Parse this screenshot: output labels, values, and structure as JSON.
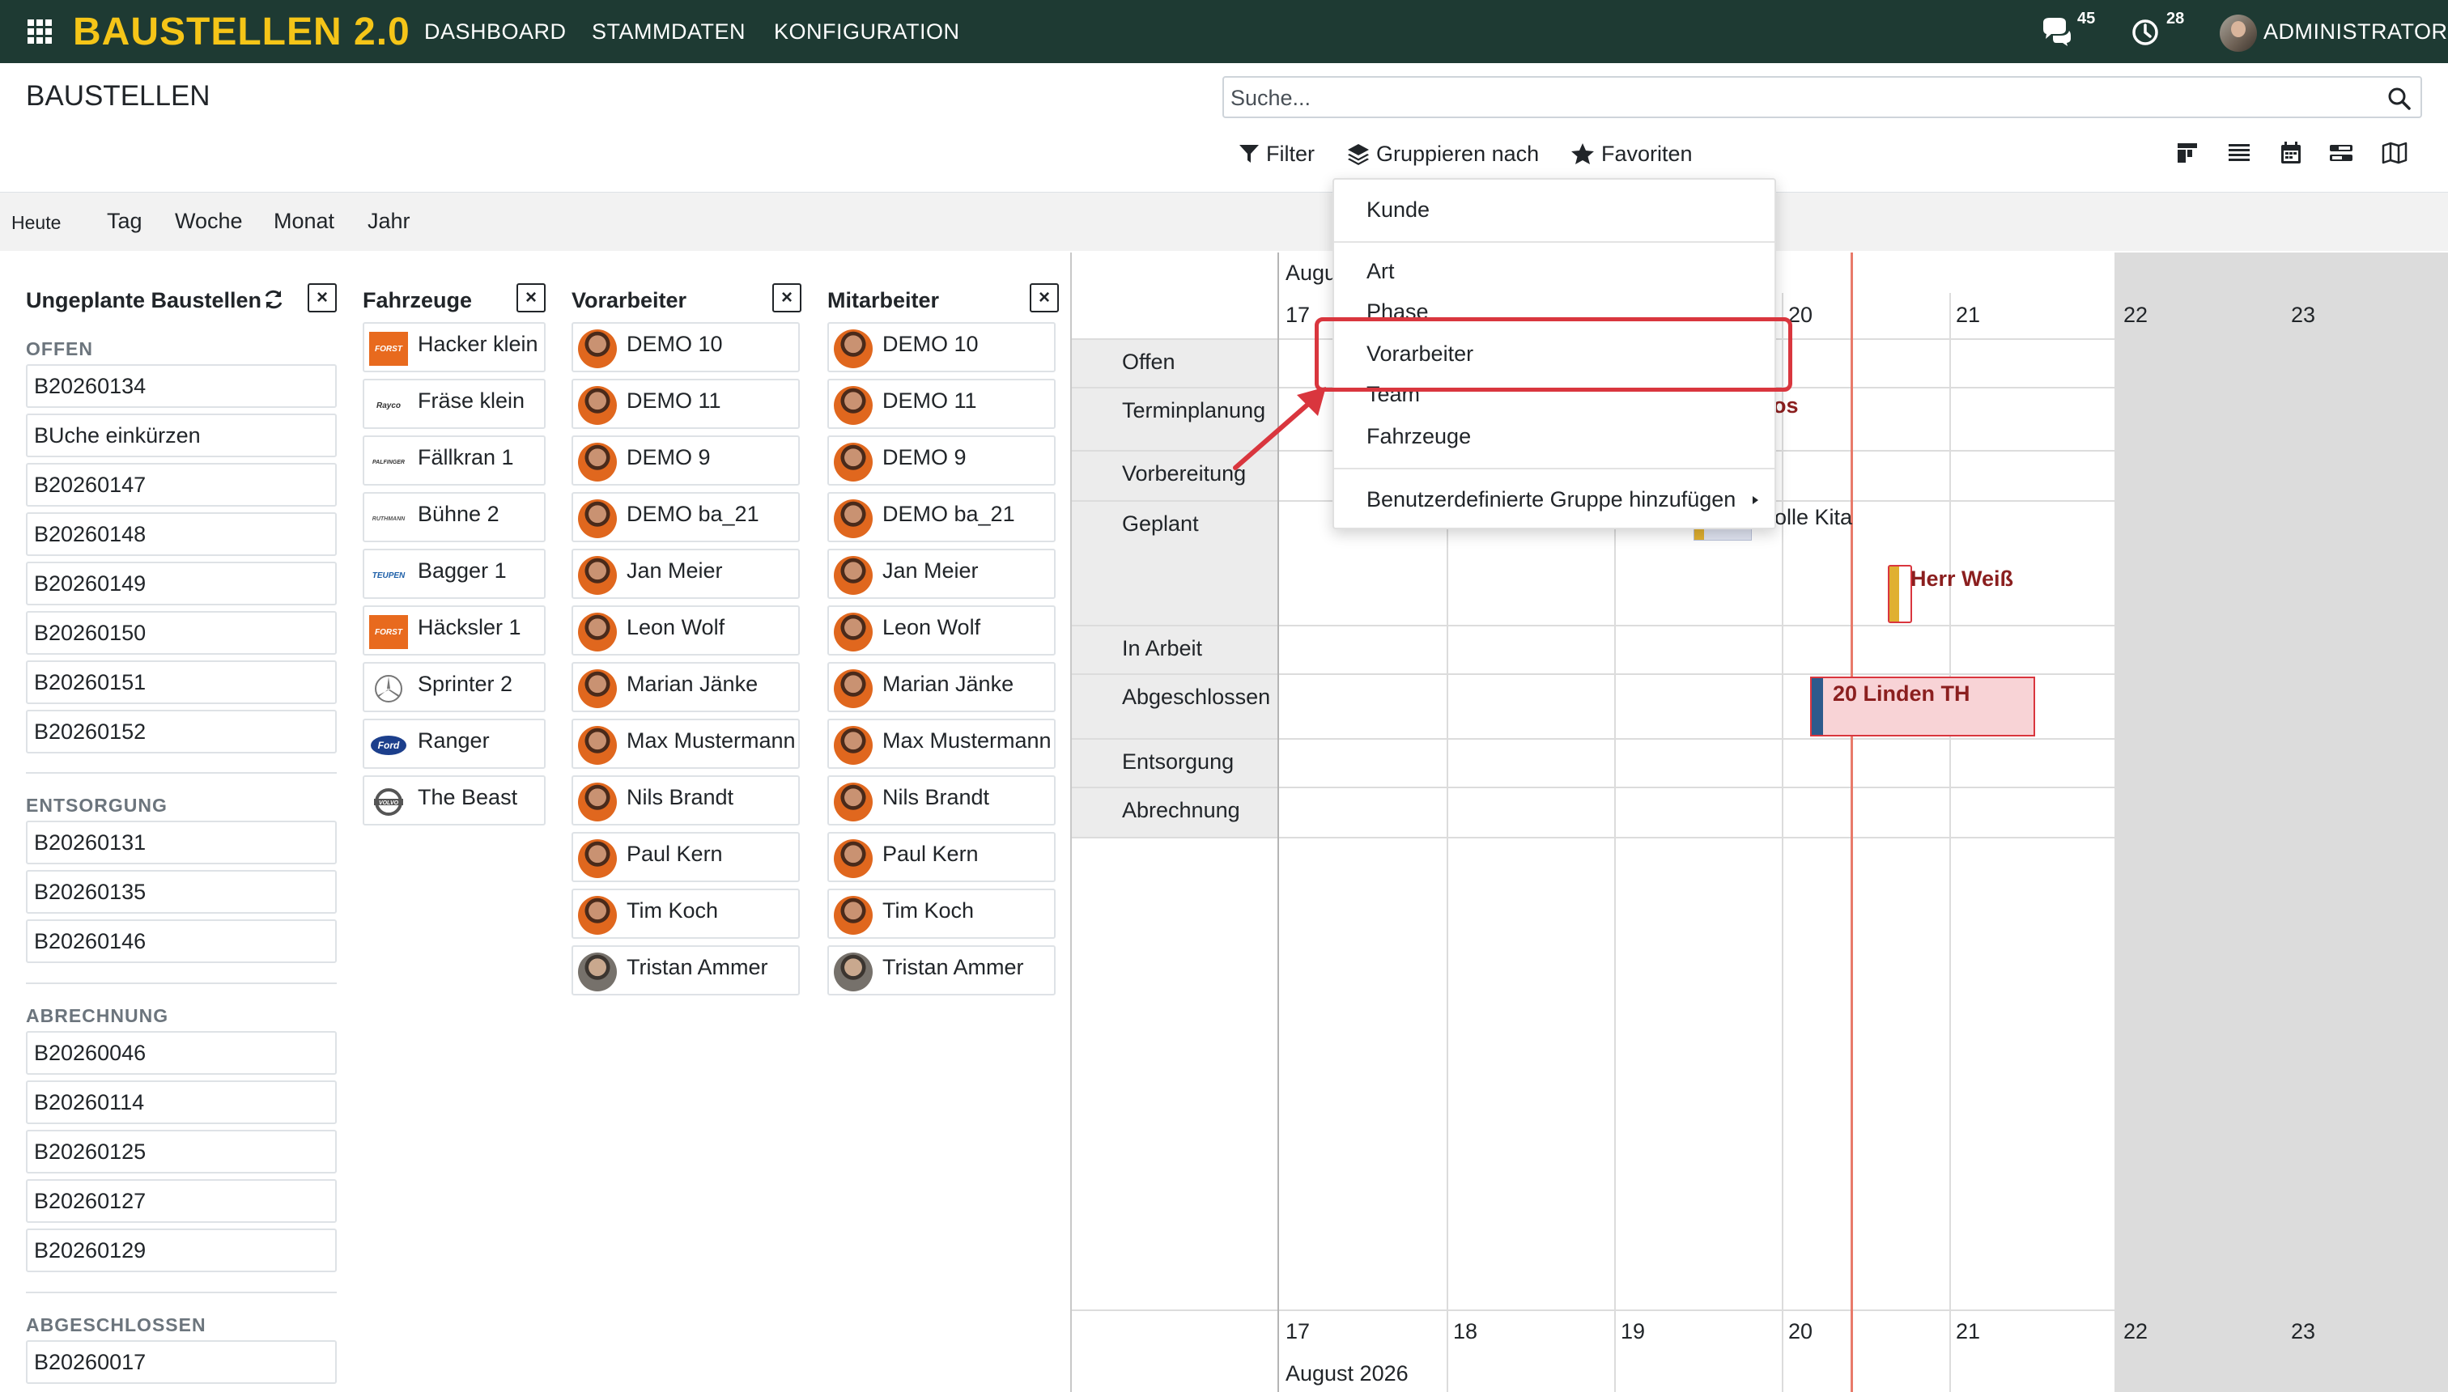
{
  "navbar": {
    "brand": "BAUSTELLEN 2.0",
    "links": [
      "DASHBOARD",
      "STAMMDATEN",
      "KONFIGURATION"
    ],
    "messages_count": "45",
    "activities_count": "28",
    "user": "ADMINISTRATOR",
    "icons": {
      "apps": "apps-grid-icon",
      "messages": "chat-icon",
      "activities": "clock-icon"
    }
  },
  "control_panel": {
    "title": "BAUSTELLEN",
    "search_placeholder": "Suche...",
    "filter_label": "Filter",
    "group_by_label": "Gruppieren nach",
    "favorites_label": "Favoriten",
    "views": [
      "kanban-icon",
      "list-icon",
      "calendar-icon",
      "timeline-icon",
      "map-icon"
    ]
  },
  "scale": {
    "today": "Heute",
    "day": "Tag",
    "week": "Woche",
    "month": "Monat",
    "year": "Jahr"
  },
  "unplanned": {
    "title": "Ungeplante Baustellen",
    "groups": [
      {
        "name": "OFFEN",
        "items": [
          "B20260134",
          "BUche einkürzen",
          "B20260147",
          "B20260148",
          "B20260149",
          "B20260150",
          "B20260151",
          "B20260152"
        ]
      },
      {
        "name": "ENTSORGUNG",
        "items": [
          "B20260131",
          "B20260135",
          "B20260146"
        ]
      },
      {
        "name": "ABRECHNUNG",
        "items": [
          "B20260046",
          "B20260114",
          "B20260125",
          "B20260127",
          "B20260129"
        ]
      },
      {
        "name": "ABGESCHLOSSEN",
        "items": [
          "B20260017"
        ]
      }
    ]
  },
  "vehicles": {
    "title": "Fahrzeuge",
    "items": [
      {
        "name": "Hacker klein",
        "logo": "FORST",
        "logo_color": "#e86a1e"
      },
      {
        "name": "Fräse klein",
        "logo": "Rayco",
        "logo_color": "#333333"
      },
      {
        "name": "Fällkran 1",
        "logo": "PALFINGER",
        "logo_color": "#333333"
      },
      {
        "name": "Bühne 2",
        "logo": "RUTHMANN",
        "logo_color": "#555555"
      },
      {
        "name": "Bagger 1",
        "logo": "TEUPEN",
        "logo_color": "#1d5fa8"
      },
      {
        "name": "Häcksler 1",
        "logo": "FORST",
        "logo_color": "#e86a1e"
      },
      {
        "name": "Sprinter 2",
        "logo": "mercedes-star-icon",
        "logo_color": "#777777"
      },
      {
        "name": "Ranger",
        "logo": "Ford",
        "logo_color": "#1c3f8c"
      },
      {
        "name": "The Beast",
        "logo": "VOLVO",
        "logo_color": "#555555"
      }
    ]
  },
  "foremen": {
    "title": "Vorarbeiter",
    "items": [
      {
        "name": "DEMO 10",
        "avatar": "orange"
      },
      {
        "name": "DEMO 11",
        "avatar": "orange"
      },
      {
        "name": "DEMO 9",
        "avatar": "orange"
      },
      {
        "name": "DEMO ba_21",
        "avatar": "orange"
      },
      {
        "name": "Jan Meier",
        "avatar": "orange"
      },
      {
        "name": "Leon Wolf",
        "avatar": "orange"
      },
      {
        "name": "Marian Jänke",
        "avatar": "orange"
      },
      {
        "name": "Max Mustermann",
        "avatar": "orange"
      },
      {
        "name": "Nils Brandt",
        "avatar": "orange"
      },
      {
        "name": "Paul Kern",
        "avatar": "orange"
      },
      {
        "name": "Tim Koch",
        "avatar": "orange"
      },
      {
        "name": "Tristan Ammer",
        "avatar": "gray"
      }
    ]
  },
  "employees": {
    "title": "Mitarbeiter",
    "items": [
      {
        "name": "DEMO 10",
        "avatar": "orange"
      },
      {
        "name": "DEMO 11",
        "avatar": "orange"
      },
      {
        "name": "DEMO 9",
        "avatar": "orange"
      },
      {
        "name": "DEMO ba_21",
        "avatar": "orange"
      },
      {
        "name": "Jan Meier",
        "avatar": "orange"
      },
      {
        "name": "Leon Wolf",
        "avatar": "orange"
      },
      {
        "name": "Marian Jänke",
        "avatar": "orange"
      },
      {
        "name": "Max Mustermann",
        "avatar": "orange"
      },
      {
        "name": "Nils Brandt",
        "avatar": "orange"
      },
      {
        "name": "Paul Kern",
        "avatar": "orange"
      },
      {
        "name": "Tim Koch",
        "avatar": "orange"
      },
      {
        "name": "Tristan Ammer",
        "avatar": "gray"
      }
    ]
  },
  "timeline": {
    "month_top": "Augu",
    "month_bottom": "August 2026",
    "days": [
      "17",
      "18",
      "19",
      "20",
      "21",
      "22",
      "23"
    ],
    "rows": [
      "Offen",
      "Terminplanung",
      "Vorbereitung",
      "Geplant",
      "In Arbeit",
      "Abgeschlossen",
      "Entsorgung",
      "Abrechnung"
    ],
    "events": [
      {
        "label": "os",
        "row": "Terminplanung",
        "color": "#8b1f1f"
      },
      {
        "label": "olle Kita",
        "row": "Geplant",
        "color": "#212529"
      },
      {
        "label": "Herr Weiß",
        "row": "Geplant",
        "color": "#8b1f1f",
        "accent": "#e0b030",
        "border": "#d9363e"
      },
      {
        "label": "20 Linden TH",
        "row": "Abgeschlossen",
        "color": "#8b1f1f",
        "accent": "#2d5a8c",
        "fill": "#f8d3d6",
        "border": "#d9363e"
      }
    ]
  },
  "group_by_dropdown": {
    "items": [
      "Kunde",
      "Art",
      "Phase",
      "Vorarbeiter",
      "Team",
      "Fahrzeuge",
      "Benutzerdefinierte Gruppe hinzufügen"
    ],
    "highlighted": "Vorarbeiter"
  },
  "colors": {
    "navbar": "#1e3a33",
    "brand": "#f5c518",
    "highlight": "#d9363e",
    "now_line": "#e87a6a"
  }
}
